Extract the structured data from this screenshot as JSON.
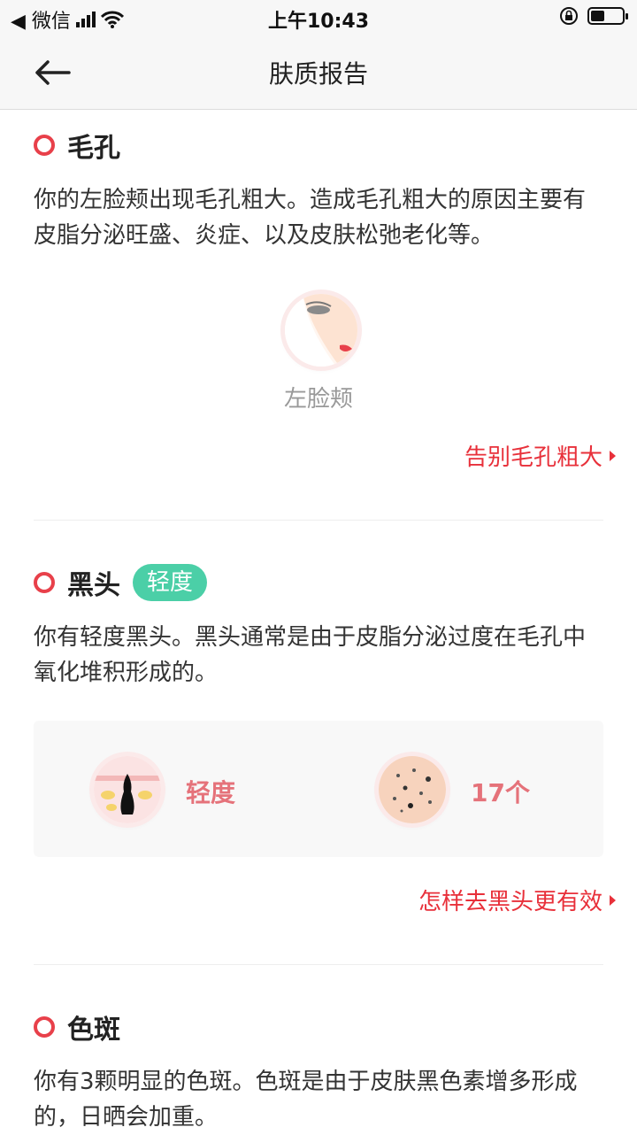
{
  "status_bar": {
    "back_app": "◀ 微信",
    "time": "上午10:43",
    "battery_level": 0.45
  },
  "nav": {
    "title": "肤质报告"
  },
  "pores": {
    "title": "毛孔",
    "description": "你的左脸颊出现毛孔粗大。造成毛孔粗大的原因主要有皮脂分泌旺盛、炎症、以及皮肤松弛老化等。",
    "region_label": "左脸颊",
    "link": "告别毛孔粗大"
  },
  "blackheads": {
    "title": "黑头",
    "badge": "轻度",
    "description": "你有轻度黑头。黑头通常是由于皮脂分泌过度在毛孔中氧化堆积形成的。",
    "severity": "轻度",
    "count": "17个",
    "link": "怎样去黑头更有效"
  },
  "spots": {
    "title": "色斑",
    "description": "你有3颗明显的色斑。色斑是由于皮肤黑色素增多形成的，日晒会加重。"
  },
  "colors": {
    "accent": "#e8303a",
    "badge": "#4bcfa7",
    "stat": "#e5727a"
  }
}
